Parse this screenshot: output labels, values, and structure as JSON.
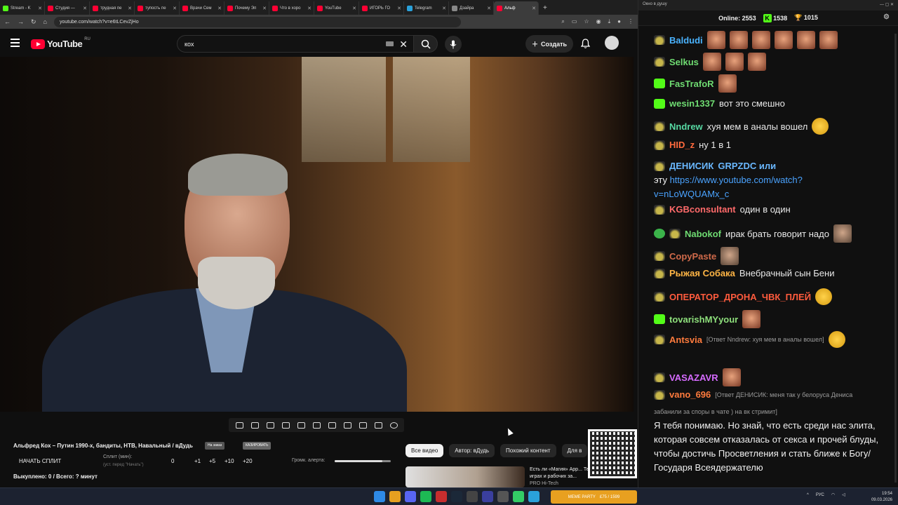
{
  "browser": {
    "tabs": [
      {
        "label": "Stream - K",
        "color": "#53fc18"
      },
      {
        "label": "Студия —",
        "color": "#ff0033"
      },
      {
        "label": "трудная пе",
        "color": "#ff0033"
      },
      {
        "label": "тупость пе",
        "color": "#ff0033"
      },
      {
        "label": "Врачи Сем",
        "color": "#ff0033"
      },
      {
        "label": "Почему Эп",
        "color": "#ff0033"
      },
      {
        "label": "Что в хоро",
        "color": "#ff0033"
      },
      {
        "label": "YouTube",
        "color": "#ff0033"
      },
      {
        "label": "ИГОРЬ ГО",
        "color": "#ff0033"
      },
      {
        "label": "Telegram",
        "color": "#2aa1da"
      },
      {
        "label": "Дзайра",
        "color": "#888888"
      },
      {
        "label": "Альф",
        "color": "#ff0033"
      }
    ],
    "new_tab": "+",
    "url": "youtube.com/watch?v=e6tLCevZjHo"
  },
  "youtube": {
    "logo_text": "YouTube",
    "logo_country": "RU",
    "search_value": "кох",
    "create_label": "Создать",
    "video_title": "Альфред Кох – Путин 1990-х, бандиты, НТВ, Навальный / вДудь",
    "chip_a": "На заказ",
    "chip_b": "КАЗИРОВАТЬ",
    "split_button": "НАЧАТЬ СПЛИТ",
    "split_label": "Сплит (мин):",
    "split_sub": "(уст. перед \"Начать\")",
    "split_value": "0",
    "split_steps": [
      "+1",
      "+5",
      "+10",
      "+20"
    ],
    "alert_volume_label": "Громк. алерта:",
    "alert_volume": 0.85,
    "bought": "Выкуплено: 0 / Всего: ? минут",
    "filter_chips": [
      "Все видео",
      "Автор: вДудь",
      "Похожий контент",
      "Для в"
    ],
    "rec_title": "Есть ли «Магия» App... Тест в играх и рабочих за...",
    "rec_channel": "PRO Hi-Tech"
  },
  "chat": {
    "window_title": "Окно в душу",
    "online_label": "Online:",
    "online_value": "2553",
    "kick_count": "1538",
    "other_count": "1015",
    "messages": [
      {
        "user": "Baldudi",
        "color": "#4ab3ff",
        "badge": "pepe",
        "text": "",
        "emotes": 6
      },
      {
        "user": "Selkus",
        "color": "#6fdc72",
        "badge": "pepe",
        "text": "",
        "emotes": 3
      },
      {
        "user": "FasTrafoR",
        "color": "#6fdc72",
        "badge": "kick",
        "text": "",
        "emotes": 1
      },
      {
        "user": "wesin1337",
        "color": "#6fdc72",
        "badge": "kick",
        "text": "вот это смешно",
        "emotes": 0
      },
      {
        "user": "Nndrew",
        "color": "#57d9a3",
        "badge": "pepe",
        "text": "хуя мем в аналы вошел",
        "emotes": 1
      },
      {
        "user": "HID_z",
        "color": "#ff6a3d",
        "badge": "pepe",
        "text": "ну 1 в 1",
        "emotes": 0
      },
      {
        "user": "ДЕНИСИК",
        "color": "#6ab8ff",
        "badge": "pepe",
        "text": "GRPZDC или",
        "emotes": 0
      },
      {
        "user": "KGBconsultant",
        "color": "#ff6a6a",
        "badge": "pepe",
        "text": "один в один",
        "emotes": 0
      },
      {
        "user": "Nabokof",
        "color": "#6fdc72",
        "badge": "pepe",
        "text": "ирак брать говорит надо",
        "emotes": 1
      },
      {
        "user": "CopyPaste",
        "color": "#d06a4a",
        "badge": "pepe",
        "text": "",
        "emotes": 1
      },
      {
        "user": "Рыжая Собака",
        "color": "#ffb545",
        "badge": "pepe",
        "text": "Внебрачный сын Бени",
        "emotes": 0
      },
      {
        "user": "ОПЕРАТОР_ДРОНА_ЧВК_ПЛЕЙ",
        "color": "#ff5b3d",
        "badge": "pepe",
        "text": "",
        "emotes": 1
      },
      {
        "user": "tovarishMYyour",
        "color": "#8ee07c",
        "badge": "kick",
        "text": "",
        "emotes": 1
      },
      {
        "user": "Antsvia",
        "color": "#ff7b3d",
        "badge": "pepe",
        "text": "[Ответ Nndrew: хуя мем в аналы вошел]",
        "emotes": 1
      },
      {
        "user": "VASAZAVR",
        "color": "#d66bff",
        "badge": "pepe",
        "text": "",
        "emotes": 1
      },
      {
        "user": "vano_696",
        "color": "#ff7b3d",
        "badge": "pepe",
        "text": "[Ответ ДЕНИСИК: меня так у белоруса Дениса",
        "emotes": 0
      }
    ],
    "link_prefix": "эту",
    "link_text": "https://www.youtube.com/watch?",
    "link_text2": "v=nLoWQUAMx_c",
    "vano_reply_line2": "забанили за споры в чате ) на вк стримит]",
    "long_message": "Я тебя понимаю. Но знай, что есть среди нас элита, которая совсем отказалась от секса и прочей блуды, чтобы достичь Просветления и стать ближе к Богу/Государя Всеядержателю"
  },
  "taskbar": {
    "app_label": "MEME PARTY",
    "app_counter": "£75 / 1599",
    "lang": "РУС",
    "time": "19:54",
    "date": "09.03.2026"
  }
}
